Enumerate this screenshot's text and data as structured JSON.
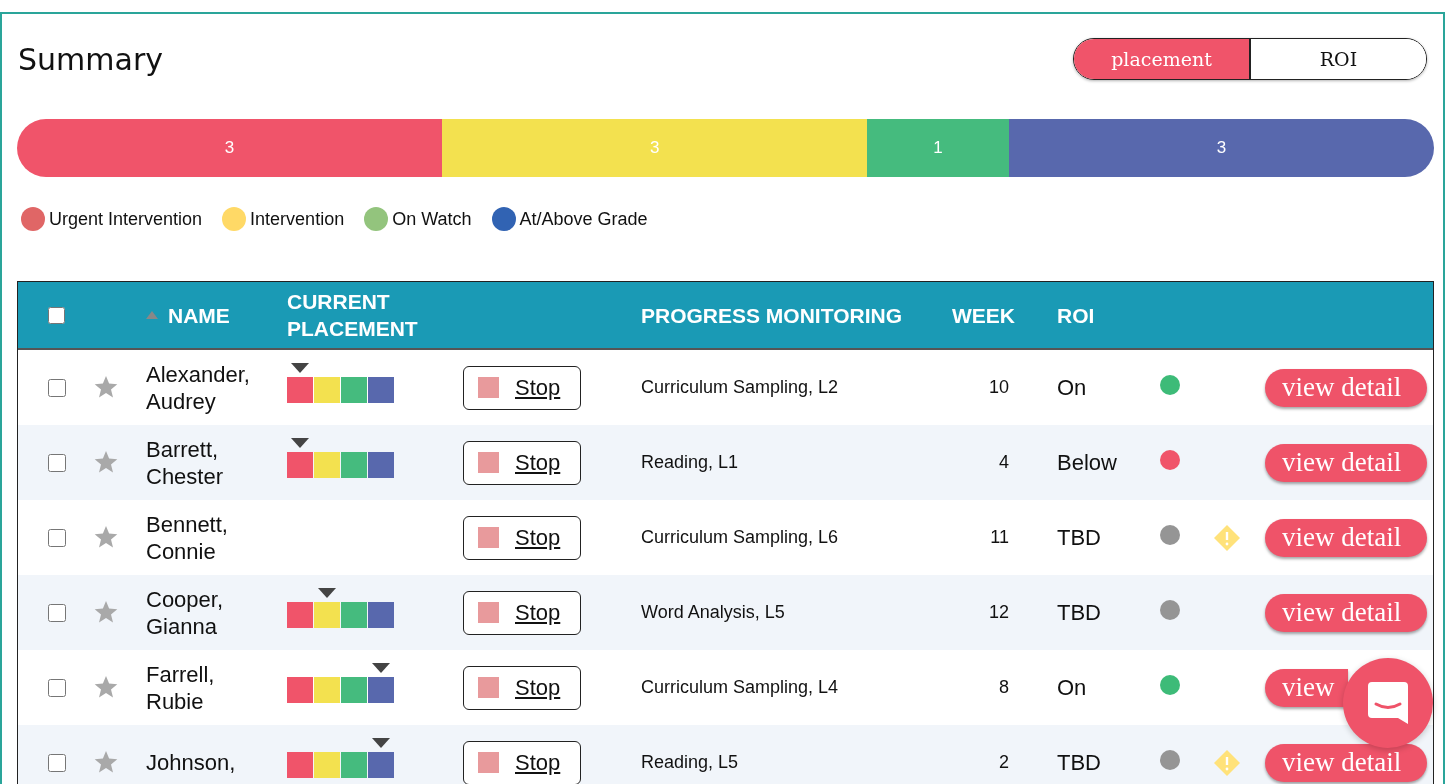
{
  "title": "Summary",
  "view_toggle": [
    {
      "label": "placement",
      "selected": true
    },
    {
      "label": "ROI",
      "selected": false
    }
  ],
  "summary_bar": [
    {
      "count": "3",
      "color": "#f0546a"
    },
    {
      "count": "3",
      "color": "#f3e14f"
    },
    {
      "count": "1",
      "color": "#45bb7e"
    },
    {
      "count": "3",
      "color": "#5868ad"
    }
  ],
  "legend": [
    {
      "label": "Urgent Intervention",
      "color": "#e06666"
    },
    {
      "label": "Intervention",
      "color": "#ffd966"
    },
    {
      "label": "On Watch",
      "color": "#93c47d"
    },
    {
      "label": "At/Above Grade",
      "color": "#3163b3"
    }
  ],
  "table": {
    "select_all_checked": false,
    "columns": [
      "NAME",
      "CURRENT PLACEMENT",
      "PROGRESS MONITORING",
      "WEEK",
      "ROI"
    ],
    "rows": [
      {
        "checked": false,
        "starred": false,
        "name": "Alexander, Audrey",
        "placement": [
          {
            "selected": true
          },
          {
            "selected": false
          },
          {
            "selected": false
          },
          {
            "selected": false
          }
        ],
        "action": "Stop",
        "progress": "Curriculum Sampling, L2",
        "week": "10",
        "roi": "On",
        "color": "#3dbb78",
        "warning": false,
        "button": "view detail"
      },
      {
        "checked": false,
        "starred": false,
        "name": "Barrett, Chester",
        "placement": [
          {
            "selected": true
          },
          {
            "selected": false
          },
          {
            "selected": false
          },
          {
            "selected": false
          }
        ],
        "action": "Stop",
        "progress": "Reading, L1",
        "week": "4",
        "roi": "Below",
        "color": "#f0546a",
        "warning": false,
        "button": "view detail"
      },
      {
        "checked": false,
        "starred": false,
        "name": "Bennett, Connie",
        "action": "Stop",
        "progress": "Curriculum Sampling, L6",
        "week": "11",
        "roi": "TBD",
        "color": "#959595",
        "warning": true,
        "button": "view detail"
      },
      {
        "checked": false,
        "starred": false,
        "name": "Cooper, Gianna",
        "placement": [
          {
            "selected": false
          },
          {
            "selected": true
          },
          {
            "selected": false
          },
          {
            "selected": false
          }
        ],
        "action": "Stop",
        "progress": "Word Analysis, L5",
        "week": "12",
        "roi": "TBD",
        "color": "#959595",
        "warning": false,
        "button": "view detail"
      },
      {
        "checked": false,
        "starred": false,
        "name": "Farrell, Rubie",
        "placement": [
          {
            "selected": false
          },
          {
            "selected": false
          },
          {
            "selected": false
          },
          {
            "selected": true
          }
        ],
        "action": "Stop",
        "progress": "Curriculum Sampling, L4",
        "week": "8",
        "roi": "On",
        "color": "#3dbb78",
        "warning": false,
        "button": "view"
      },
      {
        "checked": false,
        "starred": false,
        "name": "Johnson,",
        "placement": [
          {
            "selected": false
          },
          {
            "selected": false
          },
          {
            "selected": false
          },
          {
            "selected": true
          }
        ],
        "action": "Stop",
        "progress": "Reading, L5",
        "week": "2",
        "roi": "TBD",
        "color": "#959595",
        "warning": true,
        "button": "view detail"
      }
    ]
  }
}
